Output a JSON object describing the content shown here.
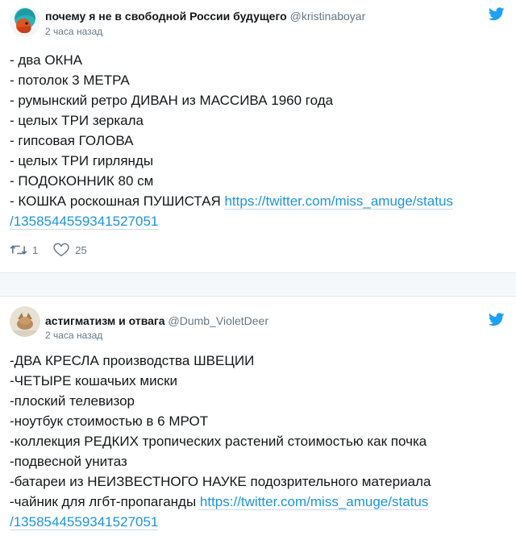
{
  "tweets": [
    {
      "name": "почему я не в свободной России будущего",
      "handle": "@kristinaboyar",
      "time": "2 часа назад",
      "lines": [
        "- два ОКНА",
        "- потолок 3 МЕТРА",
        "- румынский ретро ДИВАН из МАССИВА 1960 года",
        "- целых ТРИ зеркала",
        "- гипсовая ГОЛОВА",
        "- целых ТРИ гирлянды",
        "- ПОДОКОННИК 80 см"
      ],
      "last_line_text": "- КОШКА роскошная ПУШИСТАЯ ",
      "link_part1": "https://twitter.com/miss_amuge/status",
      "link_part2": "/1358544559341527051",
      "retweets": "1",
      "likes": "25"
    },
    {
      "name": "астигматизм и отвага",
      "handle": "@Dumb_VioletDeer",
      "time": "2 часа назад",
      "lines": [
        "-ДВА КРЕСЛА производства ШВЕЦИИ",
        "-ЧЕТЫРЕ кошачьих миски",
        "-плоский телевизор",
        "-ноутбук стоимостью в 6 МРОТ",
        "-коллекция РЕДКИХ тропических растений стоимостью как почка",
        "-подвесной унитаз",
        "-батареи из НЕИЗВЕСТНОГО НАУКЕ подозрительного материала"
      ],
      "last_line_text": "-чайник для лгбт-пропаганды ",
      "link_part1": "https://twitter.com/miss_amuge/status",
      "link_part2": "/1358544559341527051"
    }
  ],
  "colors": {
    "link": "#1b95e0",
    "muted": "#657786",
    "twitter_blue": "#1da1f2"
  },
  "icons": [
    "twitter-bird-icon",
    "retweet-icon",
    "heart-icon"
  ]
}
